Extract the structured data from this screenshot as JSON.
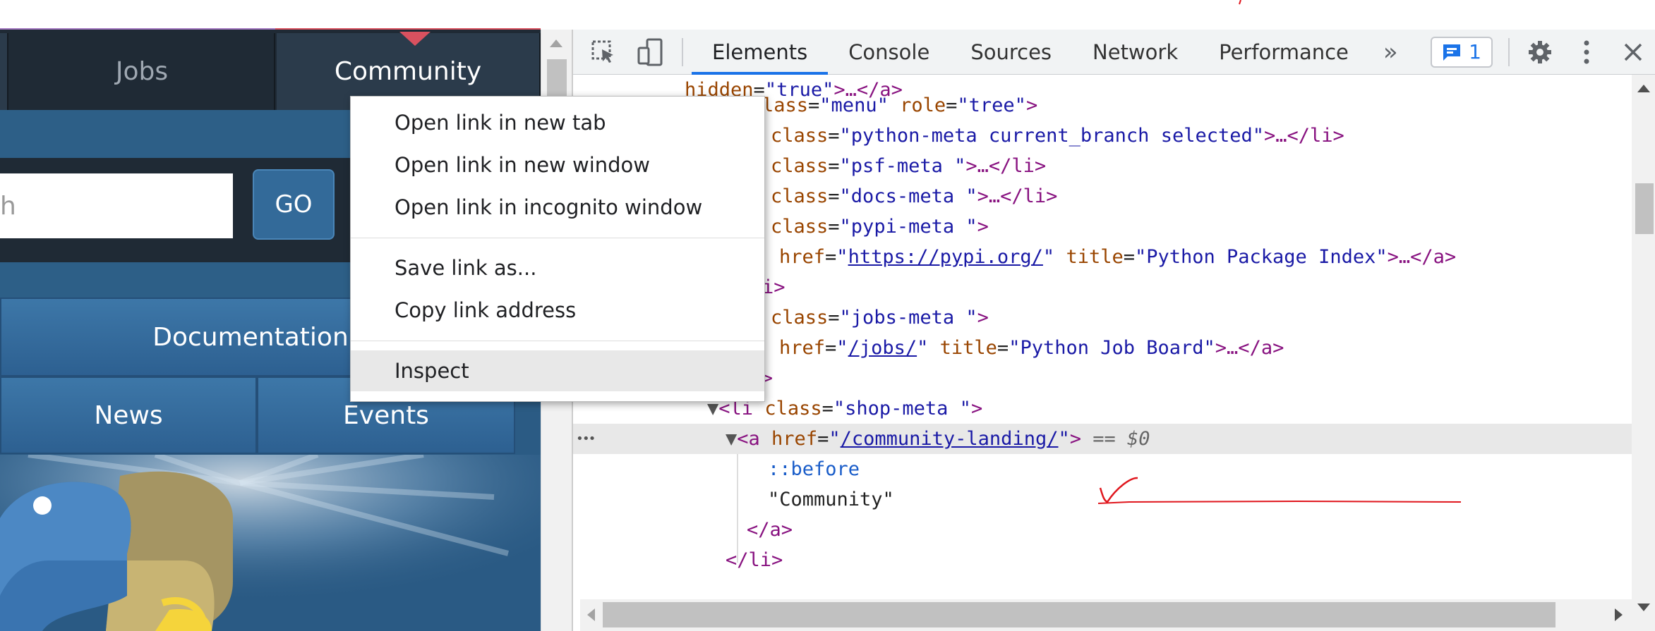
{
  "site": {
    "nav_tabs": [
      {
        "label": "Jobs"
      },
      {
        "label": "Community"
      }
    ],
    "search_placeholder_fragment": "h",
    "go_label": "GO",
    "menu": {
      "documentation": "Documentation",
      "news": "News",
      "events": "Events"
    }
  },
  "devtools": {
    "tabs": [
      "Elements",
      "Console",
      "Sources",
      "Network",
      "Performance"
    ],
    "active_tab": "Elements",
    "more_tabs": "»",
    "issues_count": "1",
    "dom": {
      "l1_attr": "hidden",
      "l1_val": "\"true\"",
      "l1_rest": ">…</a>",
      "l2_attr": "lass",
      "l2_val1": "\"menu\"",
      "l2_attr2": "role",
      "l2_val2": "\"tree\"",
      "l3_val": "\"python-meta current_branch selected\"",
      "l3_rest": ">…</li>",
      "l4_val": "\"psf-meta \"",
      "l4_rest": ">…</li>",
      "l5_val": "\"docs-meta \"",
      "l5_rest": ">…</li>",
      "l6_val": "\"pypi-meta \"",
      "l6_rest": ">",
      "l7_href": "https://pypi.org/",
      "l7_title": "\"Python Package Index\"",
      "l7_rest": ">…</a>",
      "l8": "i>",
      "l9_val": "\"jobs-meta \"",
      "l9_rest": ">",
      "l10_href": "/jobs/",
      "l10_title": "\"Python Job Board\"",
      "l10_rest": ">…</a>",
      "l11": "/li>",
      "l12_tag": "<li",
      "l12_val": "\"shop-meta \"",
      "l12_rest": ">",
      "l13_tag": "<a",
      "l13_href": "/community-landing/",
      "l13_rest": ">",
      "l13_eq": "== $0",
      "l14": "::before",
      "l15": "\"Community\"",
      "l16": "</a>",
      "l17": "</li>",
      "word_class": "class",
      "word_href": "href",
      "word_title": "title",
      "eq": "=",
      "quote": "\""
    },
    "gutter_dots": "•••"
  },
  "context_menu": {
    "items": [
      "Open link in new tab",
      "Open link in new window",
      "Open link in incognito window",
      "Save link as...",
      "Copy link address",
      "Inspect"
    ]
  },
  "colors": {
    "accent": "#1a73e8",
    "annotation": "#e0161d",
    "nav_stripe_left": "#a276c0",
    "nav_stripe_right": "#d9515f"
  }
}
